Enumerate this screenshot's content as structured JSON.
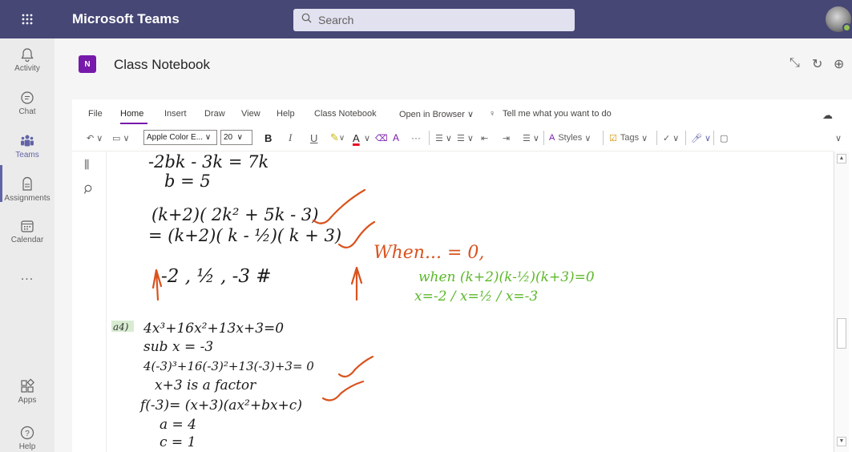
{
  "app": {
    "title": "Microsoft Teams",
    "search_placeholder": "Search"
  },
  "rail": [
    {
      "label": "Activity",
      "icon": "bell-icon"
    },
    {
      "label": "Chat",
      "icon": "chat-icon"
    },
    {
      "label": "Teams",
      "icon": "teams-icon",
      "active": true
    },
    {
      "label": "Assignments",
      "icon": "assignments-icon"
    },
    {
      "label": "Calendar",
      "icon": "calendar-icon"
    },
    {
      "label": "...",
      "icon": "more-icon"
    },
    {
      "label": "Apps",
      "icon": "apps-icon"
    },
    {
      "label": "Help",
      "icon": "help-icon"
    }
  ],
  "header": {
    "title": "Class Notebook"
  },
  "ribbon": {
    "tabs": [
      "File",
      "Home",
      "Insert",
      "Draw",
      "View",
      "Help",
      "Class Notebook",
      "Open in Browser ∨",
      "Tell me what you want to do"
    ],
    "active_tab": "Home",
    "font_name": "Apple Color E...",
    "font_size": "20",
    "styles_label": "Styles",
    "tags_label": "Tags"
  },
  "notes": {
    "lines_black": [
      "-2bk - 3k = 7k",
      "b = 5",
      "(k+2)( 2k² + 5k - 3)",
      "= (k+2)( k - ½)( k + 3)",
      "-2 , ½ , -3 #",
      "4x³+16x²+13x+3=0",
      "sub x = -3",
      "4(-3)³+16(-3)²+13(-3)+3= 0",
      "x+3 is a factor",
      "f(-3)= (x+3)(ax²+bx+c)",
      "a = 4",
      "c = 1"
    ],
    "question_label": "a4)",
    "orange_text": "When... = 0,",
    "green_lines": [
      "when (k+2)(k-½)(k+3)=0",
      "x=-2 / x=½ / x=-3"
    ]
  },
  "colors": {
    "teams_purple": "#464775",
    "accent": "#6264a7",
    "onenote": "#7719aa",
    "ink_orange": "#d9531e",
    "ink_green": "#5cb82a"
  }
}
